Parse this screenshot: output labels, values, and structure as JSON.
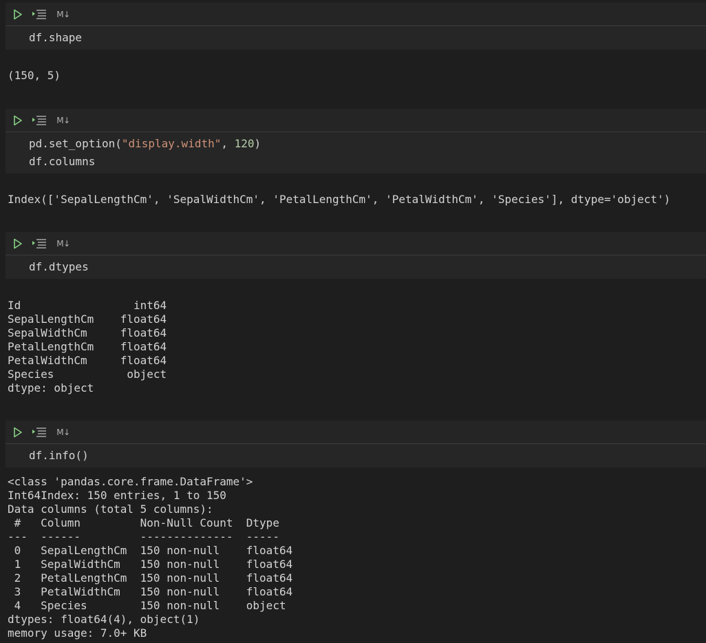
{
  "markdown_label": "M↓",
  "cells": [
    {
      "code_lines": [
        "df.shape"
      ],
      "output": "(150, 5)"
    },
    {
      "code_line1_prefix": "pd.set_option(",
      "code_line1_string": "\"display.width\"",
      "code_line1_sep": ", ",
      "code_line1_number": "120",
      "code_line1_suffix": ")",
      "code_line2": "df.columns",
      "output": "Index(['SepalLengthCm', 'SepalWidthCm', 'PetalLengthCm', 'PetalWidthCm', 'Species'], dtype='object')"
    },
    {
      "code_lines": [
        "df.dtypes"
      ],
      "output": "Id                 int64\nSepalLengthCm    float64\nSepalWidthCm     float64\nPetalLengthCm    float64\nPetalWidthCm     float64\nSpecies           object\ndtype: object"
    },
    {
      "code_lines": [
        "df.info()"
      ],
      "output": "<class 'pandas.core.frame.DataFrame'>\nInt64Index: 150 entries, 1 to 150\nData columns (total 5 columns):\n #   Column         Non-Null Count  Dtype  \n---  ------         --------------  -----  \n 0   SepalLengthCm  150 non-null    float64\n 1   SepalWidthCm   150 non-null    float64\n 2   PetalLengthCm  150 non-null    float64\n 3   PetalWidthCm   150 non-null    float64\n 4   Species        150 non-null    object \ndtypes: float64(4), object(1)\nmemory usage: 7.0+ KB"
    }
  ],
  "icons": {
    "run": "play-icon",
    "run_above": "run-above-icon",
    "markdown": "markdown-icon"
  },
  "colors": {
    "background": "#1e1e1e",
    "toolbar": "#252526",
    "code_background": "#262626",
    "run_icon": "#89d185",
    "string": "#ce9178",
    "number": "#b5cea8",
    "text": "#d4d4d4"
  }
}
